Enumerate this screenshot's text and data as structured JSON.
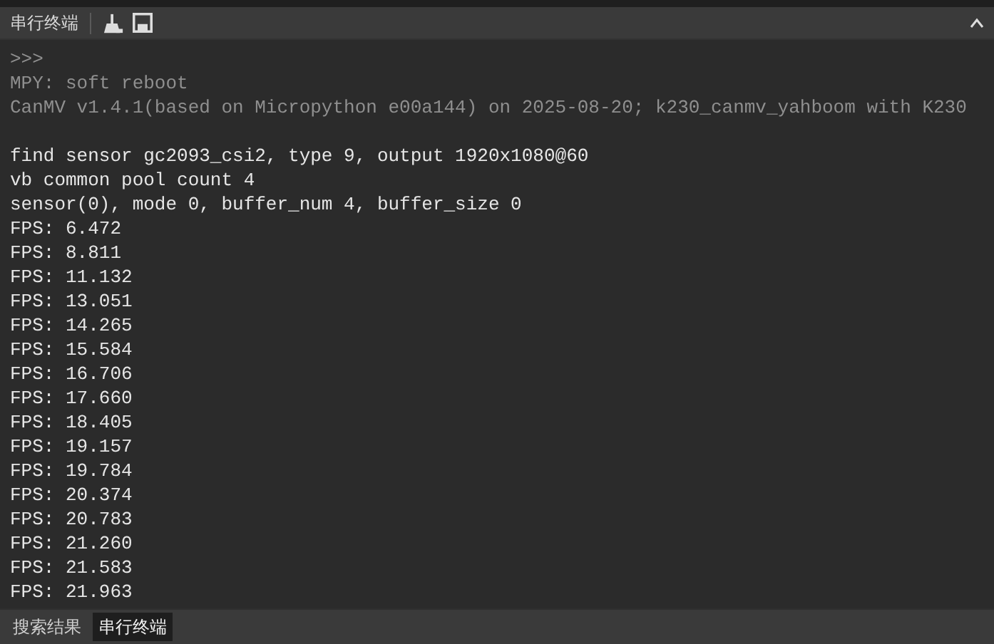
{
  "panel": {
    "title": "串行终端"
  },
  "terminal": {
    "boot_lines": [
      ">>>",
      "MPY: soft reboot",
      "CanMV v1.4.1(based on Micropython e00a144) on 2025-08-20; k230_canmv_yahboom with K230"
    ],
    "output_lines": [
      "find sensor gc2093_csi2, type 9, output 1920x1080@60",
      "vb common pool count 4",
      "sensor(0), mode 0, buffer_num 4, buffer_size 0",
      "FPS: 6.472",
      "FPS: 8.811",
      "FPS: 11.132",
      "FPS: 13.051",
      "FPS: 14.265",
      "FPS: 15.584",
      "FPS: 16.706",
      "FPS: 17.660",
      "FPS: 18.405",
      "FPS: 19.157",
      "FPS: 19.784",
      "FPS: 20.374",
      "FPS: 20.783",
      "FPS: 21.260",
      "FPS: 21.583",
      "FPS: 21.963"
    ]
  },
  "tabs": [
    {
      "label": "搜索结果",
      "selected": false
    },
    {
      "label": "串行终端",
      "selected": true
    }
  ]
}
